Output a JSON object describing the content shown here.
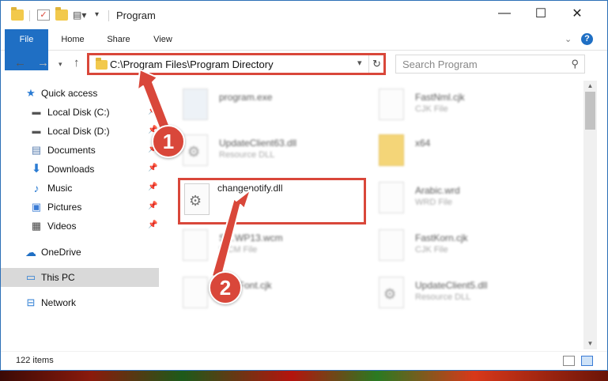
{
  "window": {
    "title": "Program"
  },
  "window_controls": {
    "minimize": "—",
    "maximize": "☐",
    "close": "✕"
  },
  "ribbon": {
    "tabs": [
      {
        "label": "File",
        "active": true
      },
      {
        "label": "Home"
      },
      {
        "label": "Share"
      },
      {
        "label": "View"
      }
    ],
    "help": "?"
  },
  "nav": {
    "address": "C:\\Program Files\\Program Directory",
    "search_placeholder": "Search Program"
  },
  "sidebar": {
    "items": [
      {
        "label": "Quick access",
        "icon": "star-icon",
        "pinned": false
      },
      {
        "label": "Local Disk (C:)",
        "icon": "drive-icon",
        "pinned": true
      },
      {
        "label": "Local Disk (D:)",
        "icon": "drive-icon",
        "pinned": true
      },
      {
        "label": "Documents",
        "icon": "documents-icon",
        "pinned": true
      },
      {
        "label": "Downloads",
        "icon": "download-icon",
        "pinned": true
      },
      {
        "label": "Music",
        "icon": "music-icon",
        "pinned": true
      },
      {
        "label": "Pictures",
        "icon": "pictures-icon",
        "pinned": true
      },
      {
        "label": "Videos",
        "icon": "videos-icon",
        "pinned": true
      },
      {
        "label": "OneDrive",
        "icon": "cloud-icon",
        "pinned": false
      },
      {
        "label": "This PC",
        "icon": "computer-icon",
        "pinned": false,
        "selected": true
      },
      {
        "label": "Network",
        "icon": "network-icon",
        "pinned": false
      }
    ]
  },
  "files": [
    {
      "name": "program.exe",
      "type": "",
      "icon": "exe-icon"
    },
    {
      "name": "FastNml.cjk",
      "type": "CJK File",
      "icon": "file-icon"
    },
    {
      "name": "UpdateClient63.dll",
      "type": "Resource DLL",
      "icon": "dll-icon"
    },
    {
      "name": "x64",
      "type": "",
      "icon": "folder-icon"
    },
    {
      "name": "changenotify.dll",
      "type": "",
      "icon": "dll-icon",
      "highlighted": true
    },
    {
      "name": "Arabic.wrd",
      "type": "WRD File",
      "icon": "file-icon"
    },
    {
      "name": "S…WP13.wcm",
      "type": "WCM File",
      "icon": "file-icon"
    },
    {
      "name": "FastKorn.cjk",
      "type": "CJK File",
      "icon": "file-icon"
    },
    {
      "name": "…ultFont.cjk",
      "type": "…le",
      "icon": "file-icon"
    },
    {
      "name": "UpdateClient5.dll",
      "type": "Resource DLL",
      "icon": "dll-icon"
    }
  ],
  "status": {
    "item_count": "122 items"
  },
  "annotations": {
    "step1": "1",
    "step2": "2",
    "color": "#d9473a"
  }
}
